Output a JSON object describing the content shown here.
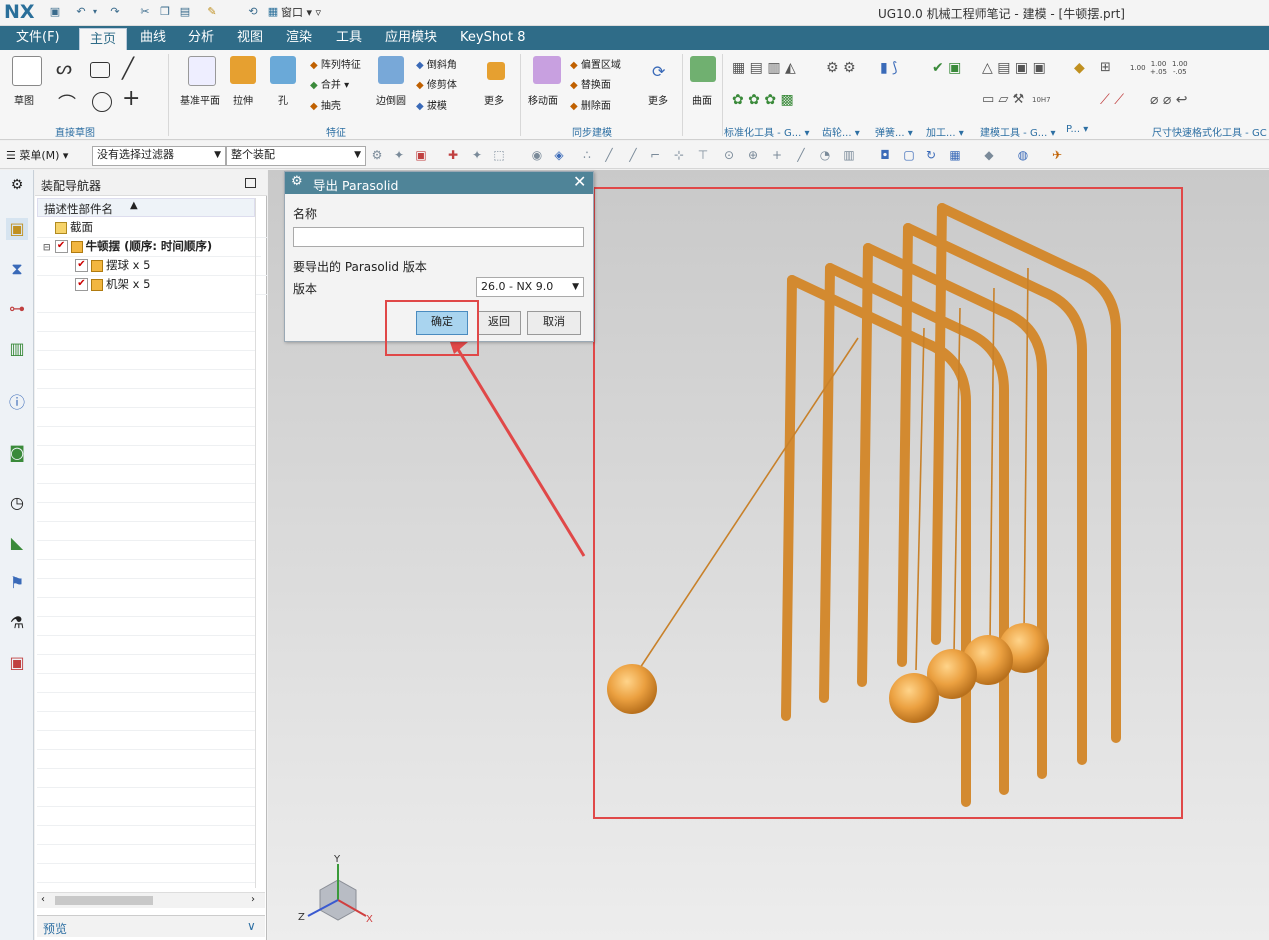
{
  "app": {
    "logo": "NX",
    "window_title": "UG10.0 机械工程师笔记 - 建模 - [牛顿摆.prt]",
    "window_menu": "窗口"
  },
  "tabs": [
    {
      "label": "文件(F)"
    },
    {
      "label": "主页"
    },
    {
      "label": "曲线"
    },
    {
      "label": "分析"
    },
    {
      "label": "视图"
    },
    {
      "label": "渲染"
    },
    {
      "label": "工具"
    },
    {
      "label": "应用模块"
    },
    {
      "label": "KeyShot 8"
    }
  ],
  "ribbon": {
    "sketch_label": "草图",
    "direct_sketch_group": "直接草图",
    "datum_plane": "基准平面",
    "extrude": "拉伸",
    "hole": "孔",
    "pattern_feature": "阵列特征",
    "unite": "合并",
    "shell": "抽壳",
    "edge_blend": "边倒圆",
    "chamfer": "倒斜角",
    "trim_body": "修剪体",
    "draft": "拔模",
    "more1": "更多",
    "feature_group": "特征",
    "move_face": "移动面",
    "offset_region": "偏置区域",
    "replace_face": "替换面",
    "delete_face": "删除面",
    "more2": "更多",
    "sync_group": "同步建模",
    "surface": "曲面",
    "std_tools_group": "标准化工具 - G...",
    "gear_group": "齿轮...",
    "spring_group": "弹簧...",
    "machining_group": "加工...",
    "modeling_tools_group": "建模工具 - G...",
    "p_group": "P...",
    "dim_format_group": "尺寸快速格式化工具 - GC",
    "dim_value": "1.00",
    "dim_tol_plus": "+.05",
    "dim_tol_minus": "-.05",
    "fit_label": "10H7"
  },
  "cmdbar": {
    "menu_label": "菜单(M)",
    "filter_value": "没有选择过滤器",
    "assembly_value": "整个装配"
  },
  "navigator": {
    "title": "装配导航器",
    "column_header": "描述性部件名",
    "rows": [
      {
        "label": "截面"
      },
      {
        "label": "牛顿摆 (顺序: 时间顺序)"
      },
      {
        "label": "摆球 x 5"
      },
      {
        "label": "机架 x 5"
      }
    ],
    "preview_label": "预览"
  },
  "dialog": {
    "title": "导出 Parasolid",
    "name_label": "名称",
    "name_value": "",
    "version_section": "要导出的 Parasolid 版本",
    "version_label": "版本",
    "version_value": "26.0 - NX 9.0",
    "ok_label": "确定",
    "back_label": "返回",
    "cancel_label": "取消"
  },
  "triad": {
    "x": "X",
    "y": "Y",
    "z": "Z"
  },
  "colors": {
    "tab_bar": "#2f6c88",
    "dialog_title": "#4f8498",
    "ok_button": "#a9d4ef",
    "highlight": "#e04848",
    "model": "#e89a3c"
  }
}
